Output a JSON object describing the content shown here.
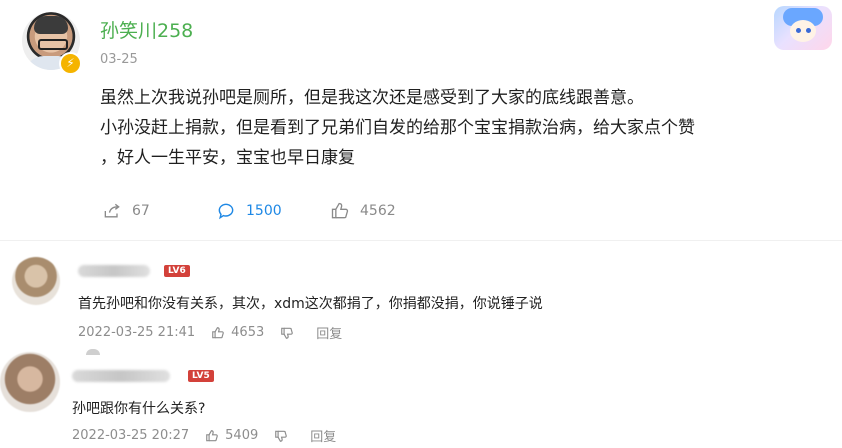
{
  "post": {
    "username": "孙笑川258",
    "date": "03-25",
    "lines": [
      "虽然上次我说孙吧是厕所，但是我这次还是感受到了大家的底线跟善意。",
      "小孙没赶上捐款，但是看到了兄弟们自发的给那个宝宝捐款治病，给大家点个赞",
      "，好人一生平安，宝宝也早日康复"
    ],
    "actions": {
      "shares": "67",
      "comments": "1500",
      "likes": "4562"
    },
    "icons": {
      "avatar": "user-avatar",
      "verified": "lightning-badge-icon",
      "share": "share-icon",
      "comment": "comment-icon",
      "like": "thumbs-up-icon",
      "sticker": "anime-sticker-icon"
    },
    "colors": {
      "username": "#4caf50",
      "active_action": "#1e88e5",
      "level_badge": "#d3413a"
    }
  },
  "comments": [
    {
      "level": "LV6",
      "text": "首先孙吧和你没有关系，其次，xdm这次都捐了，你捐都没捐，你说锤子说",
      "timestamp": "2022-03-25 21:41",
      "likes": "4653",
      "reply_label": "回复"
    },
    {
      "level": "LV5",
      "text": "孙吧跟你有什么关系?",
      "timestamp": "2022-03-25 20:27",
      "likes": "5409",
      "reply_label": "回复"
    }
  ]
}
